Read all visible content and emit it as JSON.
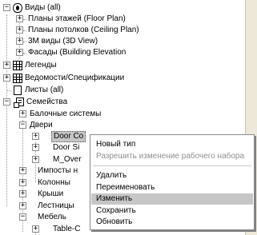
{
  "tree": {
    "views": {
      "label": "Виды (all)",
      "children": [
        "Планы этажей (Floor Plan)",
        "Планы потолков (Ceiling Plan)",
        "3М виды (3D View)",
        "Фасады (Building Elevation"
      ]
    },
    "legends": "Легенды",
    "schedules": "Ведомости/Спецификации",
    "sheets": "Листы (all)",
    "families": {
      "label": "Семейства",
      "children": {
        "beam_systems": "Балочные системы",
        "doors": {
          "label": "Двери",
          "children": [
            "Door Co",
            "Door Si",
            "M_Over"
          ]
        },
        "imposts": "Импосты н",
        "columns": "Колонны",
        "roofs": "Крыши",
        "stairs": "Лестницы",
        "furniture": {
          "label": "Мебель",
          "children": [
            "Table-C"
          ]
        }
      }
    }
  },
  "context_menu": {
    "items": [
      {
        "label": "Новый тип",
        "enabled": true
      },
      {
        "label": "Разрешить изменение рабочего набора",
        "enabled": false
      },
      {
        "separator": true
      },
      {
        "label": "Удалить",
        "enabled": true
      },
      {
        "label": "Переименовать",
        "enabled": true
      },
      {
        "label": "Изменить",
        "enabled": true,
        "highlighted": true
      },
      {
        "label": "Сохранить",
        "enabled": true
      },
      {
        "label": "Обновить",
        "enabled": true
      }
    ]
  }
}
